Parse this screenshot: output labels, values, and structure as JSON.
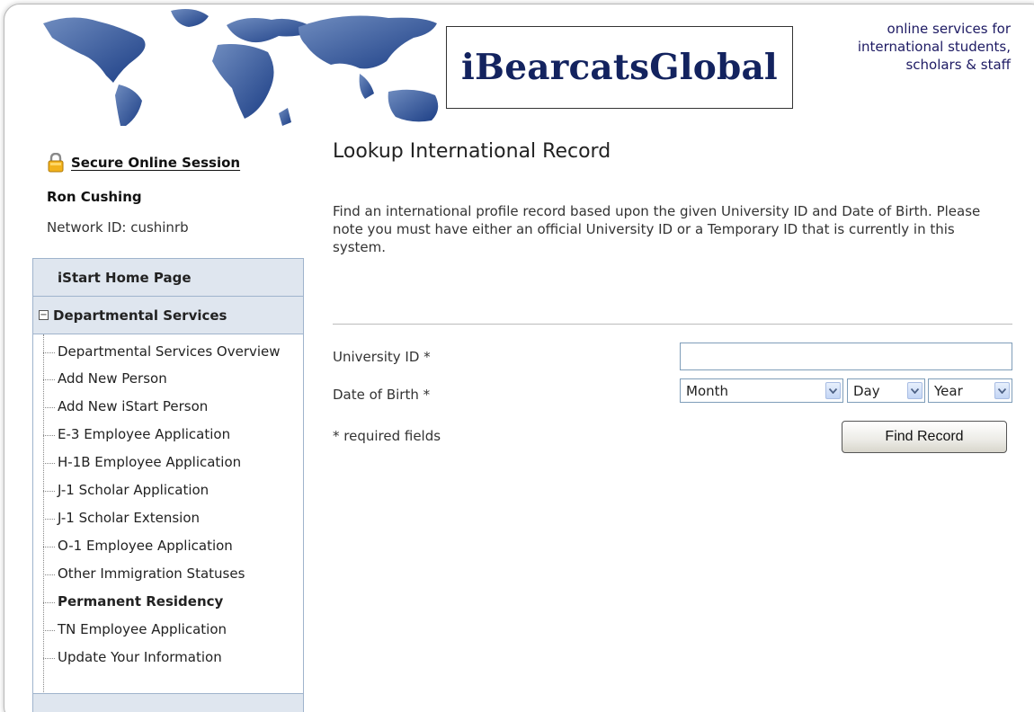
{
  "header": {
    "logo_text": "iBearcatsGlobal",
    "tagline": [
      "online services for",
      "international students,",
      "scholars & staff"
    ]
  },
  "session": {
    "secure_label": "Secure Online Session",
    "user_name": "Ron Cushing",
    "network_id": "Network ID: cushinrb"
  },
  "nav": {
    "home_label": "iStart Home Page",
    "section_label": "Departmental Services",
    "items": [
      "Departmental Services Overview",
      "Add New Person",
      "Add New iStart Person",
      "E-3 Employee Application",
      "H-1B Employee Application",
      "J-1 Scholar Application",
      "J-1 Scholar Extension",
      "O-1 Employee Application",
      "Other Immigration Statuses",
      "Permanent Residency",
      "TN Employee Application",
      "Update Your Information"
    ]
  },
  "main": {
    "title": "Lookup International Record",
    "intro": "Find an international profile record based upon the given University ID and Date of Birth. Please note you must have either an official University ID or a Temporary ID that is currently in this system.",
    "form": {
      "university_id_label": "University ID *",
      "university_id_value": "",
      "dob_label": "Date of Birth *",
      "month_value": "Month",
      "day_value": "Day",
      "year_value": "Year",
      "required_note": "* required fields",
      "submit_label": "Find Record"
    }
  },
  "colors": {
    "logo": "#13235f",
    "tagline": "#1d1a63",
    "nav_header_bg": "#dfe6ef",
    "nav_border": "#9fb3cc"
  }
}
